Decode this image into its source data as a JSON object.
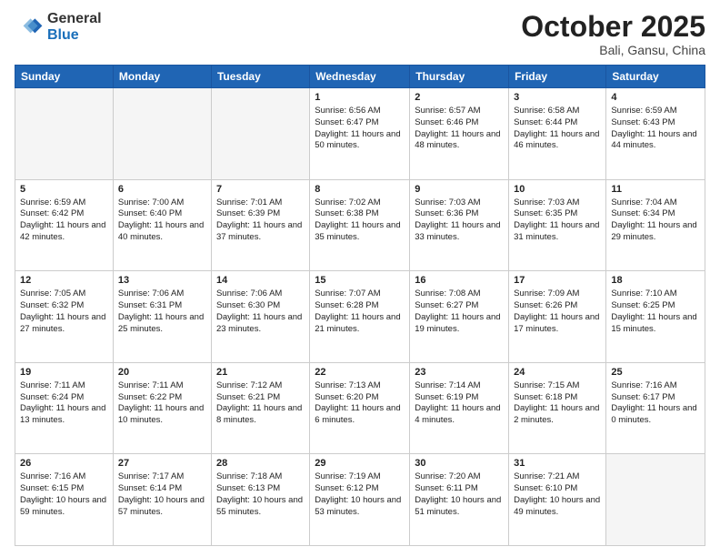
{
  "header": {
    "logo_general": "General",
    "logo_blue": "Blue",
    "month": "October 2025",
    "location": "Bali, Gansu, China"
  },
  "days_of_week": [
    "Sunday",
    "Monday",
    "Tuesday",
    "Wednesday",
    "Thursday",
    "Friday",
    "Saturday"
  ],
  "weeks": [
    [
      {
        "day": "",
        "info": ""
      },
      {
        "day": "",
        "info": ""
      },
      {
        "day": "",
        "info": ""
      },
      {
        "day": "1",
        "info": "Sunrise: 6:56 AM\nSunset: 6:47 PM\nDaylight: 11 hours and 50 minutes."
      },
      {
        "day": "2",
        "info": "Sunrise: 6:57 AM\nSunset: 6:46 PM\nDaylight: 11 hours and 48 minutes."
      },
      {
        "day": "3",
        "info": "Sunrise: 6:58 AM\nSunset: 6:44 PM\nDaylight: 11 hours and 46 minutes."
      },
      {
        "day": "4",
        "info": "Sunrise: 6:59 AM\nSunset: 6:43 PM\nDaylight: 11 hours and 44 minutes."
      }
    ],
    [
      {
        "day": "5",
        "info": "Sunrise: 6:59 AM\nSunset: 6:42 PM\nDaylight: 11 hours and 42 minutes."
      },
      {
        "day": "6",
        "info": "Sunrise: 7:00 AM\nSunset: 6:40 PM\nDaylight: 11 hours and 40 minutes."
      },
      {
        "day": "7",
        "info": "Sunrise: 7:01 AM\nSunset: 6:39 PM\nDaylight: 11 hours and 37 minutes."
      },
      {
        "day": "8",
        "info": "Sunrise: 7:02 AM\nSunset: 6:38 PM\nDaylight: 11 hours and 35 minutes."
      },
      {
        "day": "9",
        "info": "Sunrise: 7:03 AM\nSunset: 6:36 PM\nDaylight: 11 hours and 33 minutes."
      },
      {
        "day": "10",
        "info": "Sunrise: 7:03 AM\nSunset: 6:35 PM\nDaylight: 11 hours and 31 minutes."
      },
      {
        "day": "11",
        "info": "Sunrise: 7:04 AM\nSunset: 6:34 PM\nDaylight: 11 hours and 29 minutes."
      }
    ],
    [
      {
        "day": "12",
        "info": "Sunrise: 7:05 AM\nSunset: 6:32 PM\nDaylight: 11 hours and 27 minutes."
      },
      {
        "day": "13",
        "info": "Sunrise: 7:06 AM\nSunset: 6:31 PM\nDaylight: 11 hours and 25 minutes."
      },
      {
        "day": "14",
        "info": "Sunrise: 7:06 AM\nSunset: 6:30 PM\nDaylight: 11 hours and 23 minutes."
      },
      {
        "day": "15",
        "info": "Sunrise: 7:07 AM\nSunset: 6:28 PM\nDaylight: 11 hours and 21 minutes."
      },
      {
        "day": "16",
        "info": "Sunrise: 7:08 AM\nSunset: 6:27 PM\nDaylight: 11 hours and 19 minutes."
      },
      {
        "day": "17",
        "info": "Sunrise: 7:09 AM\nSunset: 6:26 PM\nDaylight: 11 hours and 17 minutes."
      },
      {
        "day": "18",
        "info": "Sunrise: 7:10 AM\nSunset: 6:25 PM\nDaylight: 11 hours and 15 minutes."
      }
    ],
    [
      {
        "day": "19",
        "info": "Sunrise: 7:11 AM\nSunset: 6:24 PM\nDaylight: 11 hours and 13 minutes."
      },
      {
        "day": "20",
        "info": "Sunrise: 7:11 AM\nSunset: 6:22 PM\nDaylight: 11 hours and 10 minutes."
      },
      {
        "day": "21",
        "info": "Sunrise: 7:12 AM\nSunset: 6:21 PM\nDaylight: 11 hours and 8 minutes."
      },
      {
        "day": "22",
        "info": "Sunrise: 7:13 AM\nSunset: 6:20 PM\nDaylight: 11 hours and 6 minutes."
      },
      {
        "day": "23",
        "info": "Sunrise: 7:14 AM\nSunset: 6:19 PM\nDaylight: 11 hours and 4 minutes."
      },
      {
        "day": "24",
        "info": "Sunrise: 7:15 AM\nSunset: 6:18 PM\nDaylight: 11 hours and 2 minutes."
      },
      {
        "day": "25",
        "info": "Sunrise: 7:16 AM\nSunset: 6:17 PM\nDaylight: 11 hours and 0 minutes."
      }
    ],
    [
      {
        "day": "26",
        "info": "Sunrise: 7:16 AM\nSunset: 6:15 PM\nDaylight: 10 hours and 59 minutes."
      },
      {
        "day": "27",
        "info": "Sunrise: 7:17 AM\nSunset: 6:14 PM\nDaylight: 10 hours and 57 minutes."
      },
      {
        "day": "28",
        "info": "Sunrise: 7:18 AM\nSunset: 6:13 PM\nDaylight: 10 hours and 55 minutes."
      },
      {
        "day": "29",
        "info": "Sunrise: 7:19 AM\nSunset: 6:12 PM\nDaylight: 10 hours and 53 minutes."
      },
      {
        "day": "30",
        "info": "Sunrise: 7:20 AM\nSunset: 6:11 PM\nDaylight: 10 hours and 51 minutes."
      },
      {
        "day": "31",
        "info": "Sunrise: 7:21 AM\nSunset: 6:10 PM\nDaylight: 10 hours and 49 minutes."
      },
      {
        "day": "",
        "info": ""
      }
    ]
  ]
}
